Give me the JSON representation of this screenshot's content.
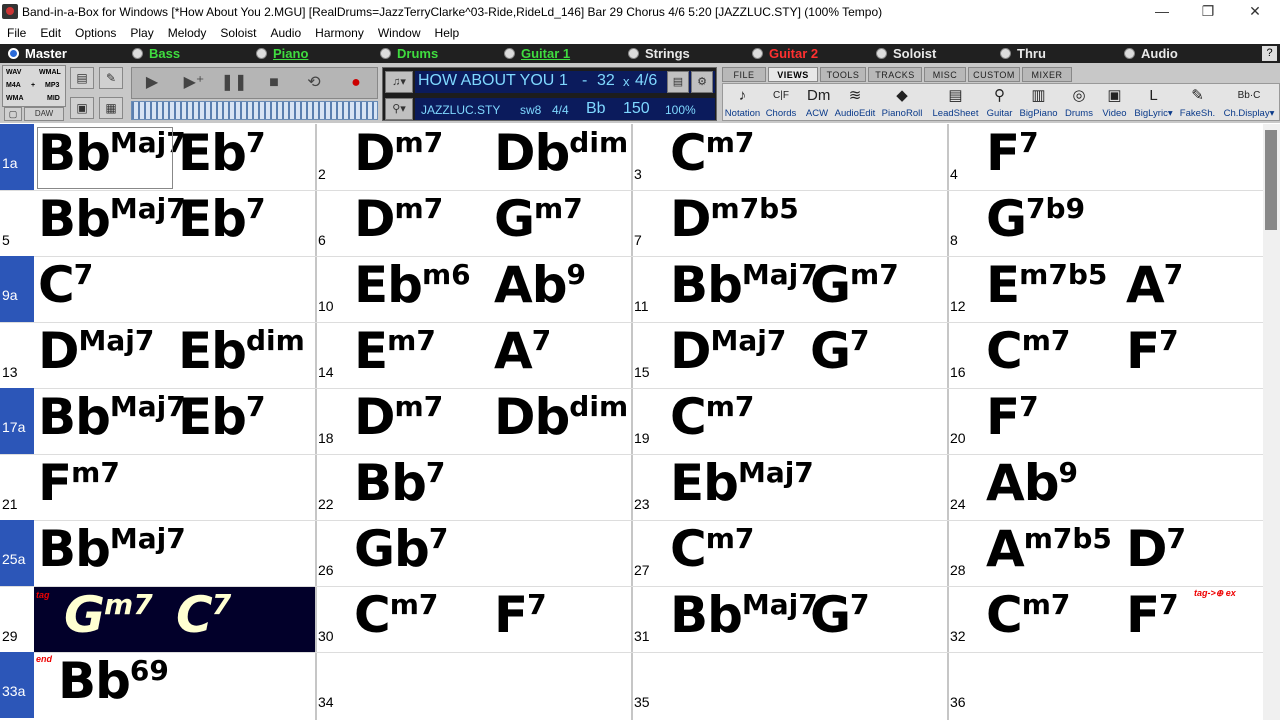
{
  "window": {
    "title": "Band-in-a-Box for Windows  [*How About You 2.MGU] [RealDrums=JazzTerryClarke^03-Ride,RideLd_146] Bar 29 Chorus 4/6   5:20  [JAZZLUC.STY] (100% Tempo)",
    "min": "—",
    "max": "❐",
    "close": "✕"
  },
  "menu": [
    "File",
    "Edit",
    "Options",
    "Play",
    "Melody",
    "Soloist",
    "Audio",
    "Harmony",
    "Window",
    "Help"
  ],
  "tracks": [
    {
      "label": "Master",
      "color": "#ffffff"
    },
    {
      "label": "Bass",
      "color": "#3fdc3f"
    },
    {
      "label": "Piano",
      "color": "#3fdc3f"
    },
    {
      "label": "Drums",
      "color": "#3fdc3f"
    },
    {
      "label": "Guitar 1",
      "color": "#3fdc3f"
    },
    {
      "label": "Strings",
      "color": "#e8e8e8"
    },
    {
      "label": "Guitar 2",
      "color": "#ff3030"
    },
    {
      "label": "Soloist",
      "color": "#e8e8e8"
    },
    {
      "label": "Thru",
      "color": "#e8e8e8"
    },
    {
      "label": "Audio",
      "color": "#e8e8e8"
    }
  ],
  "help": "?",
  "formats": {
    "wav": "WAV",
    "wma_l": "WMAL",
    "m4a": "M4A",
    "plus": "+",
    "mp3": "MP3",
    "wma": "WMA",
    "mid": "MID",
    "daw": "DAW"
  },
  "song": {
    "title": "HOW ABOUT YOU",
    "from": "1",
    "dash": "-",
    "to": "32",
    "x": "x",
    "chorus": "4/6",
    "style": "JAZZLUC.STY",
    "feel": "sw8",
    "meter": "4/4",
    "key": "Bb",
    "tempo": "150",
    "pct": "100%"
  },
  "tabs": [
    "FILE",
    "VIEWS",
    "TOOLS",
    "TRACKS",
    "MISC",
    "CUSTOM",
    "MIXER"
  ],
  "views": [
    {
      "label": "Notation",
      "icon": "♪"
    },
    {
      "label": "Chords",
      "icon": "C|F"
    },
    {
      "label": "ACW",
      "icon": "Dm"
    },
    {
      "label": "AudioEdit",
      "icon": "≋"
    },
    {
      "label": "PianoRoll",
      "icon": "◆"
    },
    {
      "label": "LeadSheet",
      "icon": "▤"
    },
    {
      "label": "Guitar",
      "icon": "⚲"
    },
    {
      "label": "BigPiano",
      "icon": "▥"
    },
    {
      "label": "Drums",
      "icon": "◎"
    },
    {
      "label": "Video",
      "icon": "▣"
    },
    {
      "label": "BigLyric▾",
      "icon": "L"
    },
    {
      "label": "FakeSh.",
      "icon": "✎"
    },
    {
      "label": "Ch.Display▾",
      "icon": "Bb·C"
    }
  ],
  "bars": [
    {
      "n": "1a",
      "section": true,
      "chords": [
        {
          "r": "Bb",
          "s": "Maj7"
        },
        {
          "r": "Eb",
          "s": "7"
        }
      ]
    },
    {
      "n": "2",
      "chords": [
        {
          "r": "D",
          "s": "m7"
        },
        {
          "r": "Db",
          "s": "dim"
        }
      ]
    },
    {
      "n": "3",
      "chords": [
        {
          "r": "C",
          "s": "m7"
        }
      ]
    },
    {
      "n": "4",
      "chords": [
        {
          "r": "F",
          "s": "7"
        }
      ]
    },
    {
      "n": "5",
      "chords": [
        {
          "r": "Bb",
          "s": "Maj7"
        },
        {
          "r": "Eb",
          "s": "7"
        }
      ]
    },
    {
      "n": "6",
      "chords": [
        {
          "r": "D",
          "s": "m7"
        },
        {
          "r": "G",
          "s": "m7"
        }
      ]
    },
    {
      "n": "7",
      "chords": [
        {
          "r": "D",
          "s": "m7b5"
        }
      ]
    },
    {
      "n": "8",
      "chords": [
        {
          "r": "G",
          "s": "7b9"
        }
      ]
    },
    {
      "n": "9a",
      "section": true,
      "chords": [
        {
          "r": "C",
          "s": "7"
        }
      ]
    },
    {
      "n": "10",
      "chords": [
        {
          "r": "Eb",
          "s": "m6"
        },
        {
          "r": "Ab",
          "s": "9"
        }
      ]
    },
    {
      "n": "11",
      "chords": [
        {
          "r": "Bb",
          "s": "Maj7"
        },
        {
          "r": "G",
          "s": "m7"
        }
      ]
    },
    {
      "n": "12",
      "chords": [
        {
          "r": "E",
          "s": "m7b5"
        },
        {
          "r": "A",
          "s": "7"
        }
      ]
    },
    {
      "n": "13",
      "chords": [
        {
          "r": "D",
          "s": "Maj7"
        },
        {
          "r": "Eb",
          "s": "dim"
        }
      ]
    },
    {
      "n": "14",
      "chords": [
        {
          "r": "E",
          "s": "m7"
        },
        {
          "r": "A",
          "s": "7"
        }
      ]
    },
    {
      "n": "15",
      "chords": [
        {
          "r": "D",
          "s": "Maj7"
        },
        {
          "r": "G",
          "s": "7"
        }
      ]
    },
    {
      "n": "16",
      "chords": [
        {
          "r": "C",
          "s": "m7"
        },
        {
          "r": "F",
          "s": "7"
        }
      ]
    },
    {
      "n": "17a",
      "section": true,
      "chords": [
        {
          "r": "Bb",
          "s": "Maj7"
        },
        {
          "r": "Eb",
          "s": "7"
        }
      ]
    },
    {
      "n": "18",
      "chords": [
        {
          "r": "D",
          "s": "m7"
        },
        {
          "r": "Db",
          "s": "dim"
        }
      ]
    },
    {
      "n": "19",
      "chords": [
        {
          "r": "C",
          "s": "m7"
        }
      ]
    },
    {
      "n": "20",
      "chords": [
        {
          "r": "F",
          "s": "7"
        }
      ]
    },
    {
      "n": "21",
      "chords": [
        {
          "r": "F",
          "s": "m7"
        }
      ]
    },
    {
      "n": "22",
      "chords": [
        {
          "r": "Bb",
          "s": "7"
        }
      ]
    },
    {
      "n": "23",
      "chords": [
        {
          "r": "Eb",
          "s": "Maj7"
        }
      ]
    },
    {
      "n": "24",
      "chords": [
        {
          "r": "Ab",
          "s": "9"
        }
      ]
    },
    {
      "n": "25a",
      "section": true,
      "chords": [
        {
          "r": "Bb",
          "s": "Maj7"
        }
      ]
    },
    {
      "n": "26",
      "chords": [
        {
          "r": "Gb",
          "s": "7"
        }
      ]
    },
    {
      "n": "27",
      "chords": [
        {
          "r": "C",
          "s": "m7"
        }
      ]
    },
    {
      "n": "28",
      "chords": [
        {
          "r": "A",
          "s": "m7b5"
        },
        {
          "r": "D",
          "s": "7"
        }
      ]
    },
    {
      "n": "29",
      "current": true,
      "chords": [
        {
          "r": "G",
          "s": "m7"
        },
        {
          "r": "C",
          "s": "7"
        }
      ]
    },
    {
      "n": "30",
      "chords": [
        {
          "r": "C",
          "s": "m7"
        },
        {
          "r": "F",
          "s": "7"
        }
      ]
    },
    {
      "n": "31",
      "chords": [
        {
          "r": "Bb",
          "s": "Maj7"
        },
        {
          "r": "G",
          "s": "7"
        }
      ]
    },
    {
      "n": "32",
      "chords": [
        {
          "r": "C",
          "s": "m7"
        },
        {
          "r": "F",
          "s": "7"
        }
      ]
    },
    {
      "n": "33a",
      "section": true,
      "chords": [
        {
          "r": "Bb",
          "s": "69"
        }
      ]
    },
    {
      "n": "34",
      "chords": []
    },
    {
      "n": "35",
      "chords": []
    },
    {
      "n": "36",
      "chords": []
    }
  ],
  "markers": {
    "tag": "tag",
    "tagex": "tag->⊕ ex",
    "end": "end"
  }
}
